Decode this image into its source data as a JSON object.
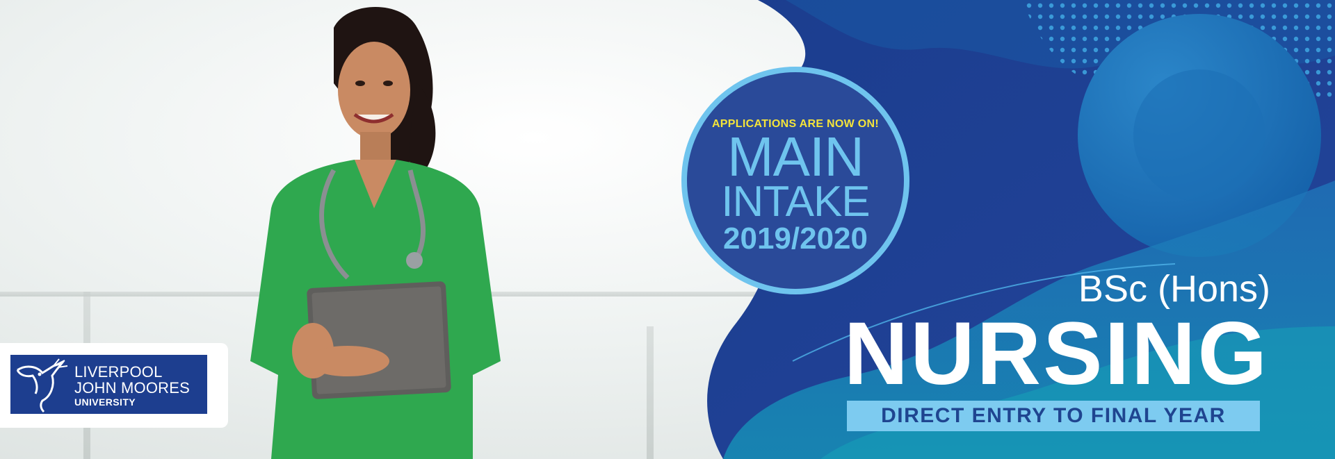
{
  "logo": {
    "line1": "LIVERPOOL",
    "line2": "JOHN MOORES",
    "line3": "UNIVERSITY"
  },
  "badge": {
    "tagline": "APPLICATIONS ARE NOW ON!",
    "main": "MAIN",
    "intake": "INTAKE",
    "year": "2019/2020"
  },
  "program": {
    "degree": "BSc (Hons)",
    "title": "NURSING",
    "entry": "DIRECT ENTRY TO FINAL YEAR"
  },
  "colors": {
    "navy": "#1d3e8f",
    "accent_blue": "#6fc4ee",
    "highlight_yellow": "#f4e43a",
    "scrubs_green": "#2fa84f"
  }
}
